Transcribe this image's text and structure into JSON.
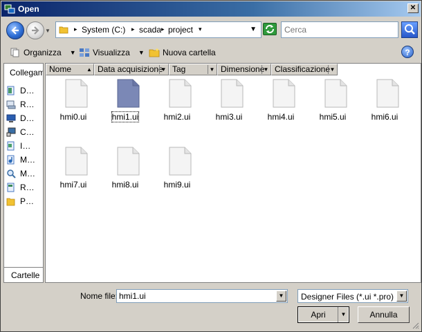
{
  "window": {
    "title": "Open"
  },
  "address": {
    "crumbs": [
      "System (C:)",
      "scada",
      "project"
    ]
  },
  "search": {
    "placeholder": "Cerca"
  },
  "toolbar": {
    "organize": "Organizza",
    "views": "Visualizza",
    "new_folder": "Nuova cartella"
  },
  "navpane": {
    "header": "Collegamenti",
    "items": [
      {
        "label": "D…",
        "icon": "documents-icon"
      },
      {
        "label": "R…",
        "icon": "recent-places-icon"
      },
      {
        "label": "D…",
        "icon": "desktop-icon"
      },
      {
        "label": "C…",
        "icon": "computer-icon"
      },
      {
        "label": "I…",
        "icon": "pictures-icon"
      },
      {
        "label": "M…",
        "icon": "music-icon"
      },
      {
        "label": "M…",
        "icon": "search-folder-icon"
      },
      {
        "label": "R…",
        "icon": "recent-icon"
      },
      {
        "label": "P…",
        "icon": "public-folder-icon"
      }
    ],
    "footer": "Cartelle"
  },
  "columns": [
    "Nome",
    "Data acquisizione",
    "Tag",
    "Dimensione",
    "Classificazione"
  ],
  "files": [
    {
      "name": "hmi0.ui",
      "selected": false
    },
    {
      "name": "hmi1.ui",
      "selected": true
    },
    {
      "name": "hmi2.ui",
      "selected": false
    },
    {
      "name": "hmi3.ui",
      "selected": false
    },
    {
      "name": "hmi4.ui",
      "selected": false
    },
    {
      "name": "hmi5.ui",
      "selected": false
    },
    {
      "name": "hmi6.ui",
      "selected": false
    },
    {
      "name": "hmi7.ui",
      "selected": false
    },
    {
      "name": "hmi8.ui",
      "selected": false
    },
    {
      "name": "hmi9.ui",
      "selected": false
    }
  ],
  "bottom": {
    "filename_label": "Nome file:",
    "filename_value": "hmi1.ui",
    "filetype_value": "Designer Files (*.ui *.pro)",
    "open_label": "Apri",
    "cancel_label": "Annulla"
  },
  "colors": {
    "title_gradient_start": "#0a246a",
    "selected_icon": "#7b88b6"
  }
}
